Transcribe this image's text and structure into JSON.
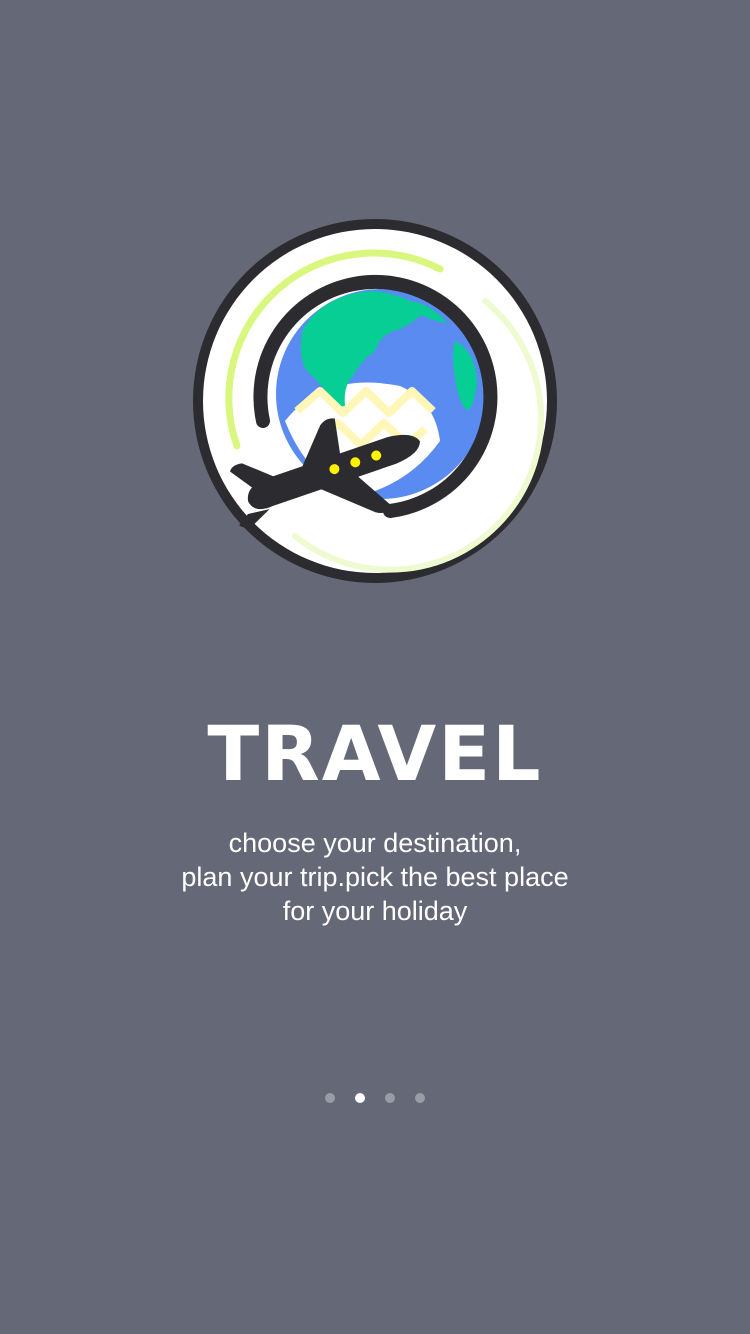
{
  "onboarding": {
    "logo_icon": "globe-airplane-icon",
    "title": "TRAVEL",
    "description_lines": [
      "choose your destination,",
      "plan your trip.pick the best place",
      "for your holiday"
    ]
  },
  "pager": {
    "total": 4,
    "active_index": 1
  },
  "colors": {
    "background": "#656876",
    "title": "#ffffff",
    "globe_land": "#06CE94",
    "globe_ocean": "#5A8BF0",
    "accent_ring": "#D9F77E",
    "outline": "#2B2B30",
    "window_lights": "#FFF200"
  }
}
